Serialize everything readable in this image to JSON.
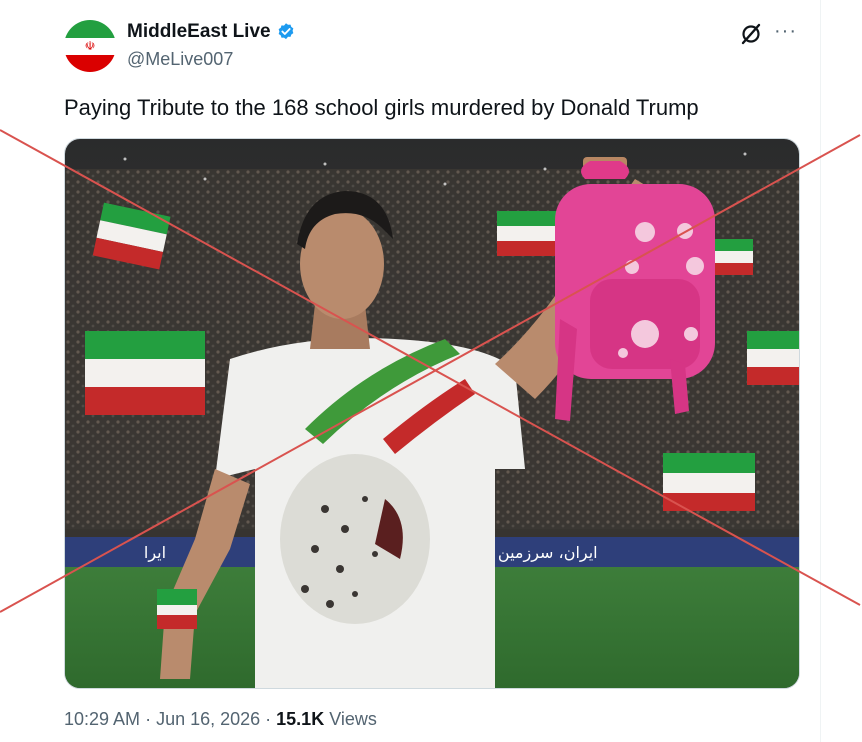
{
  "author": {
    "display_name": "MiddleEast Live",
    "handle": "@MeLive007",
    "verified": true,
    "avatar_icon": "iran-flag-avatar"
  },
  "actions": {
    "grok_icon": "grok-icon",
    "more_icon": "more-icon",
    "more_label": "···"
  },
  "tweet": {
    "text": "Paying Tribute to the 168 school girls murdered by Donald Trump"
  },
  "media": {
    "banner_text": "ایران، سرزمین یوز",
    "banner_text_left": "ایرا"
  },
  "meta": {
    "time": "10:29 AM",
    "sep1": " · ",
    "date": "Jun 16, 2026",
    "sep2": " · ",
    "views_count": "15.1K",
    "views_label": " Views"
  },
  "colors": {
    "strike_line": "#d9534f",
    "verified_blue": "#1d9bf0",
    "secondary_text": "#536471"
  }
}
